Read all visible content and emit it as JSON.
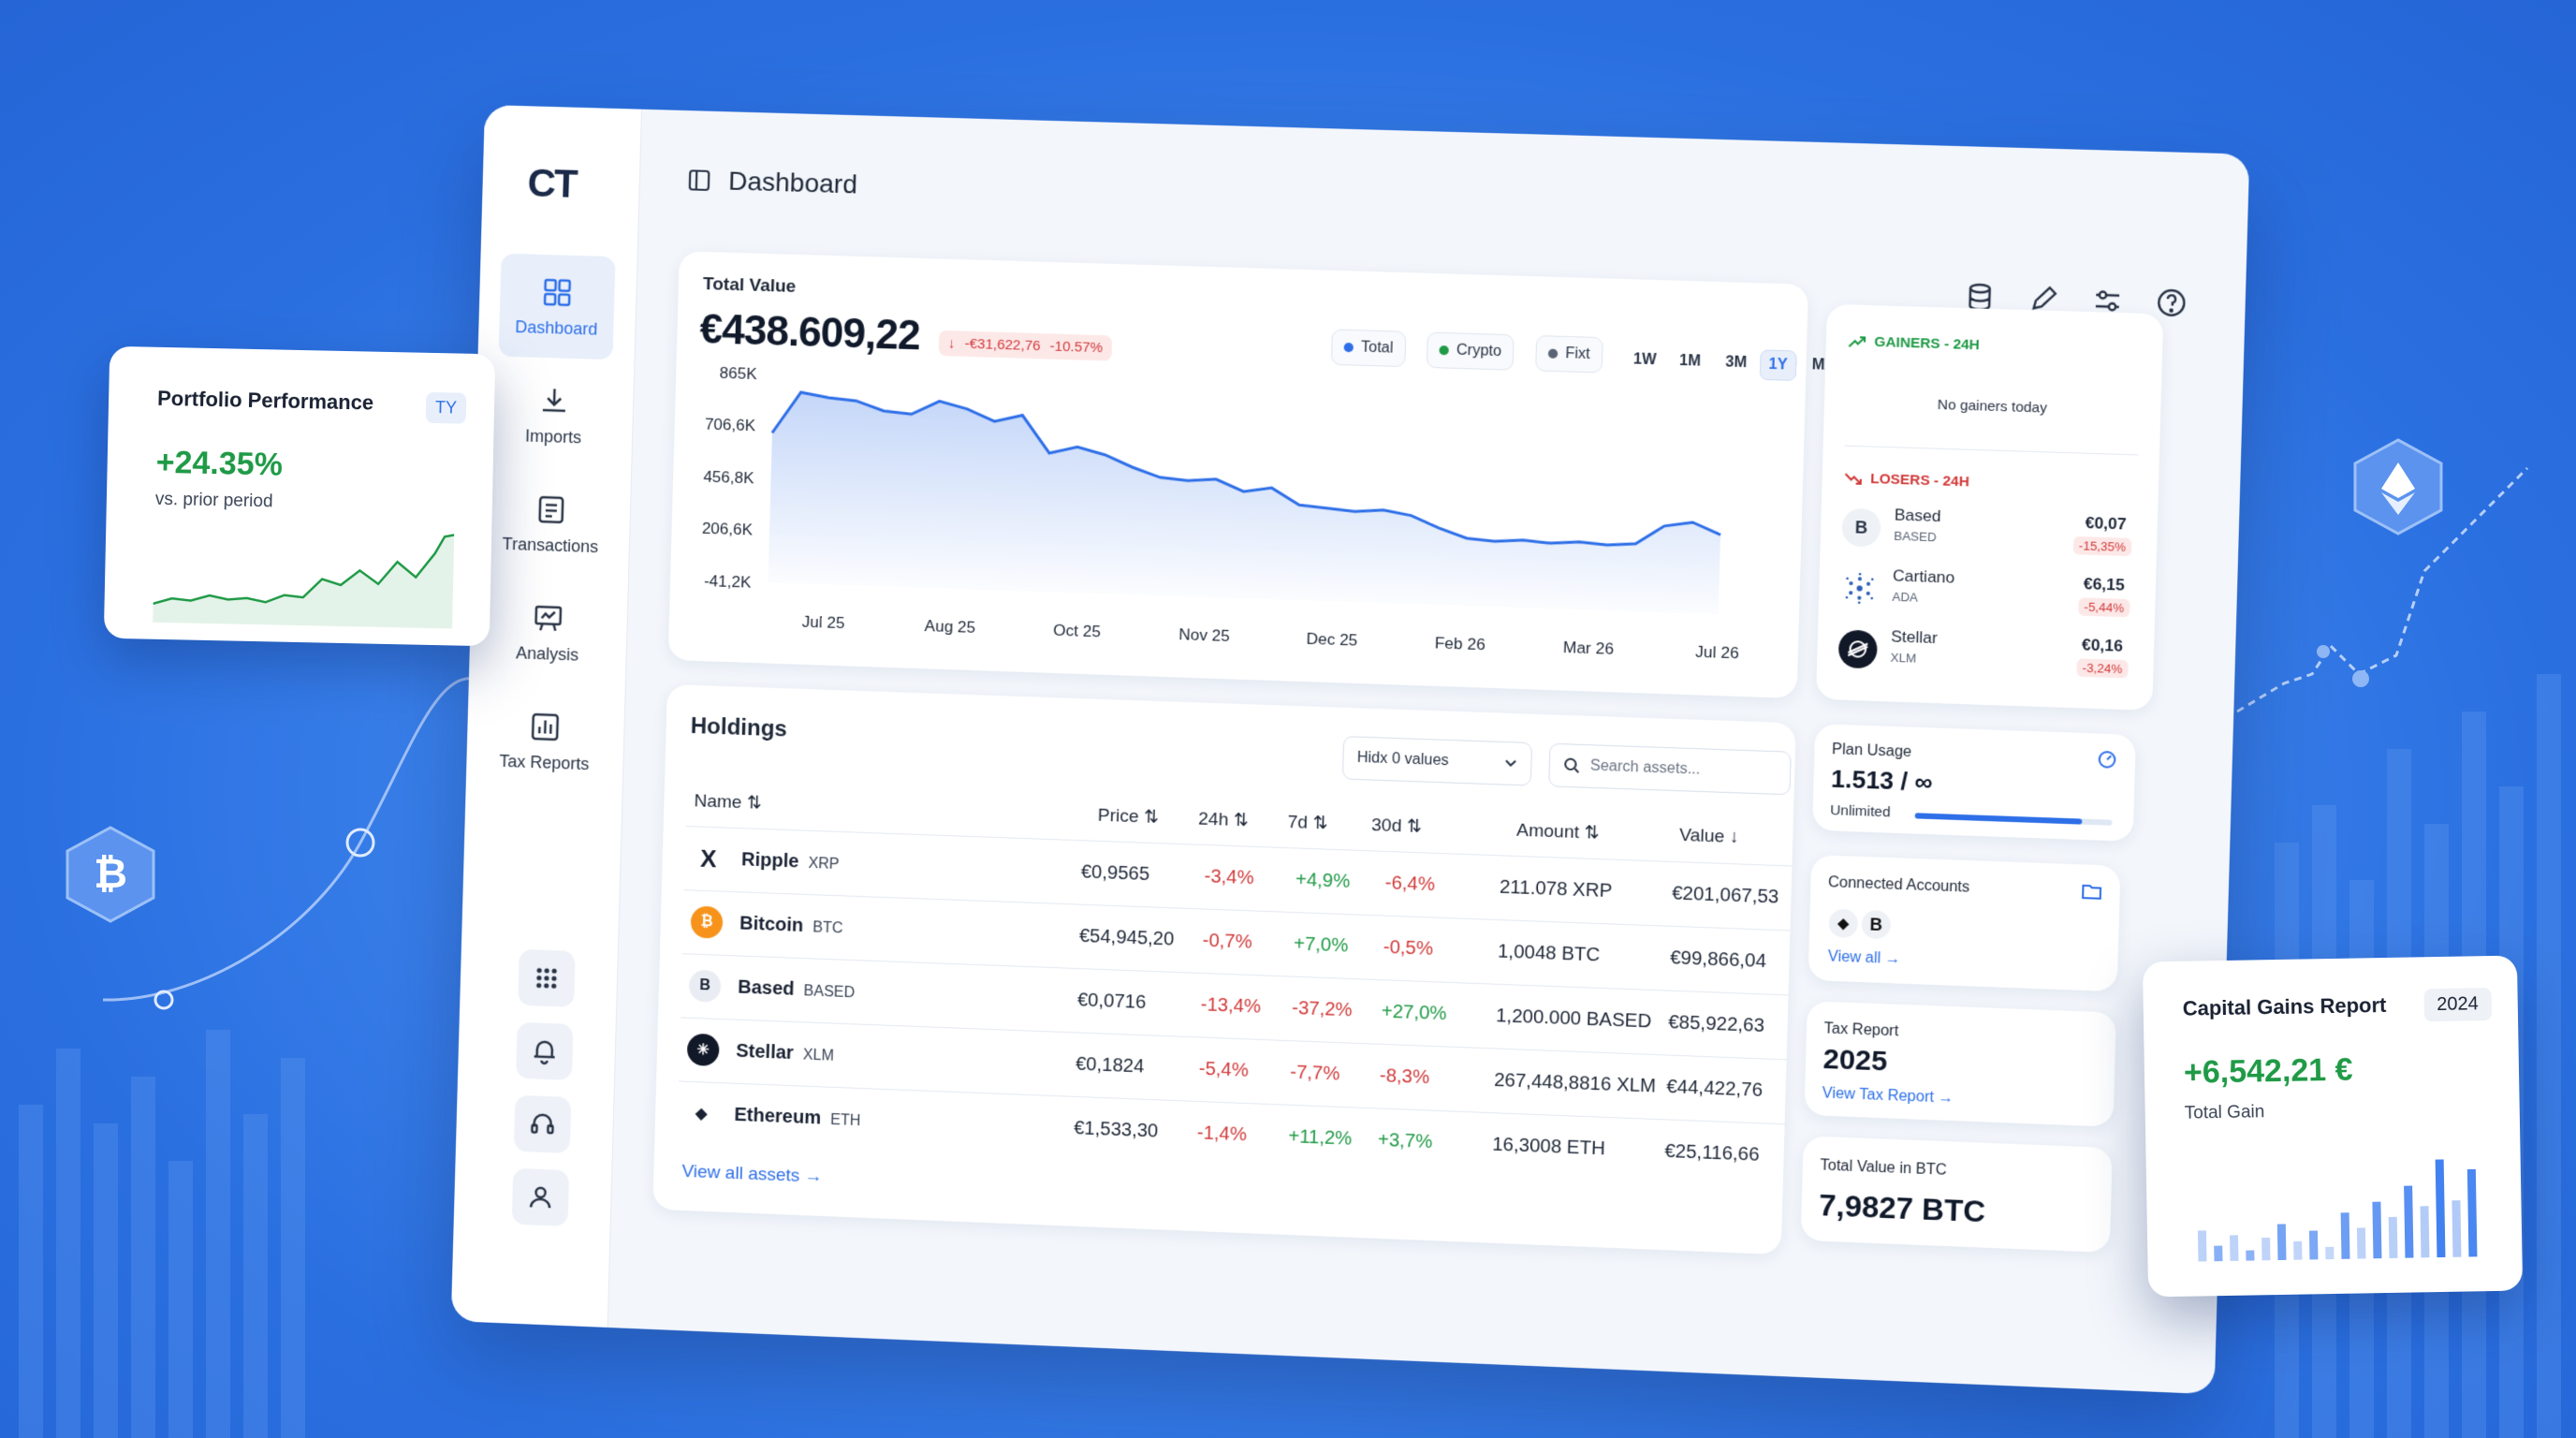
{
  "sidebar": {
    "logo": "CT",
    "items": [
      {
        "label": "Dashboard",
        "icon": "grid-icon"
      },
      {
        "label": "Imports",
        "icon": "download-icon"
      },
      {
        "label": "Transactions",
        "icon": "list-icon"
      },
      {
        "label": "Analysis",
        "icon": "presentation-icon"
      },
      {
        "label": "Tax Reports",
        "icon": "bar-chart-icon"
      }
    ],
    "utility": [
      "apps-icon",
      "bell-icon",
      "headset-icon",
      "user-icon"
    ]
  },
  "header": {
    "title": "Dashboard"
  },
  "total_value": {
    "title": "Total Value",
    "value": "€438.609,22",
    "change": "-€31,622,76",
    "change_pct": "-10.57%",
    "filters": [
      "Total",
      "Crypto",
      "Fixt"
    ],
    "ranges": [
      "1W",
      "1M",
      "3M",
      "1Y",
      "MAX"
    ],
    "selected_range": "1Y"
  },
  "chart_data": {
    "type": "area",
    "x": [
      "Jul 25",
      "Aug 25",
      "Oct 25",
      "Nov 25",
      "Dec 25",
      "Feb 26",
      "Mar 26",
      "Jul 26"
    ],
    "y_ticks": [
      "865K",
      "706,6K",
      "456,8K",
      "206,6K",
      "-41,2K"
    ],
    "values_k": [
      610,
      790,
      770,
      760,
      720,
      710,
      770,
      740,
      690,
      720,
      560,
      590,
      560,
      510,
      470,
      460,
      470,
      420,
      440,
      370,
      360,
      350,
      360,
      340,
      290,
      250,
      240,
      250,
      240,
      250,
      240,
      250,
      330,
      350,
      300
    ],
    "ylim": [
      -41.2,
      865
    ],
    "line_color": "#2e6fe8",
    "xlabel": "",
    "ylabel": ""
  },
  "gainers": {
    "title": "GAINERS - 24H",
    "empty": "No gainers today"
  },
  "losers": {
    "title": "LOSERS - 24H",
    "items": [
      {
        "name": "Based",
        "symbol": "BASED",
        "price": "€0,07",
        "change": "-15,35%",
        "icon": "B"
      },
      {
        "name": "Cartiano",
        "symbol": "ADA",
        "price": "€6,15",
        "change": "-5,44%",
        "icon": "cardano-icon"
      },
      {
        "name": "Stellar",
        "symbol": "XLM",
        "price": "€0,16",
        "change": "-3,24%",
        "icon": "stellar-icon"
      }
    ]
  },
  "plan": {
    "title": "Plan Usage",
    "value": "1.513 / ∞",
    "label": "Unlimited",
    "usage": 0.85
  },
  "connected": {
    "title": "Connected Accounts",
    "link": "View all"
  },
  "tax": {
    "title": "Tax Report",
    "year": "2025",
    "link": "View Tax Report"
  },
  "btc_value": {
    "title": "Total Value in BTC",
    "value": "7,9827 BTC"
  },
  "holdings": {
    "title": "Holdings",
    "dropdown": "Hidx 0 values",
    "search_placeholder": "Search assets...",
    "columns": [
      "Name ⇅",
      "Price ⇅",
      "24h ⇅",
      "7d ⇅",
      "30d ⇅",
      "Amount ⇅",
      "Value ↓"
    ],
    "rows": [
      {
        "name": "Ripple",
        "sym": "XRP",
        "price": "€0,9565",
        "d1": "-3,4%",
        "d7": "+4,9%",
        "d30": "-6,4%",
        "amount": "211.078 XRP",
        "value": "€201,067,53",
        "icon": "X",
        "color": "#1a2233"
      },
      {
        "name": "Bitcoin",
        "sym": "BTC",
        "price": "€54,945,20",
        "d1": "-0,7%",
        "d7": "+7,0%",
        "d30": "-0,5%",
        "amount": "1,0048 BTC",
        "value": "€99,866,04",
        "icon": "₿",
        "color": "#f7931a"
      },
      {
        "name": "Based",
        "sym": "BASED",
        "price": "€0,0716",
        "d1": "-13,4%",
        "d7": "-37,2%",
        "d30": "+27,0%",
        "amount": "1,200.000 BASED",
        "value": "€85,922,63",
        "icon": "B",
        "color": "#e9edf3"
      },
      {
        "name": "Stellar",
        "sym": "XLM",
        "price": "€0,1824",
        "d1": "-5,4%",
        "d7": "-7,7%",
        "d30": "-8,3%",
        "amount": "267,448,8816 XLM",
        "value": "€44,422,76",
        "icon": "✳",
        "color": "#111827"
      },
      {
        "name": "Ethereum",
        "sym": "ETH",
        "price": "€1,533,30",
        "d1": "-1,4%",
        "d7": "+11,2%",
        "d30": "+3,7%",
        "amount": "16,3008 ETH",
        "value": "€25,116,66",
        "icon": "◆",
        "color": "#ffffff"
      }
    ],
    "link": "View all assets"
  },
  "portfolio": {
    "title": "Portfolio Performance",
    "badge": "TY",
    "value": "+24.35%",
    "sub": "vs. prior period"
  },
  "capital": {
    "title": "Capital Gains Report",
    "year": "2024",
    "value": "+6,542,21 €",
    "label": "Total Gain",
    "bars": [
      0.3,
      0.15,
      0.25,
      0.1,
      0.22,
      0.35,
      0.18,
      0.28,
      0.12,
      0.45,
      0.3,
      0.55,
      0.4,
      0.7,
      0.5,
      0.95,
      0.55,
      0.85
    ]
  },
  "colors": {
    "accent": "#2e6fe8",
    "positive": "#1f9a46",
    "negative": "#d23a3a"
  }
}
